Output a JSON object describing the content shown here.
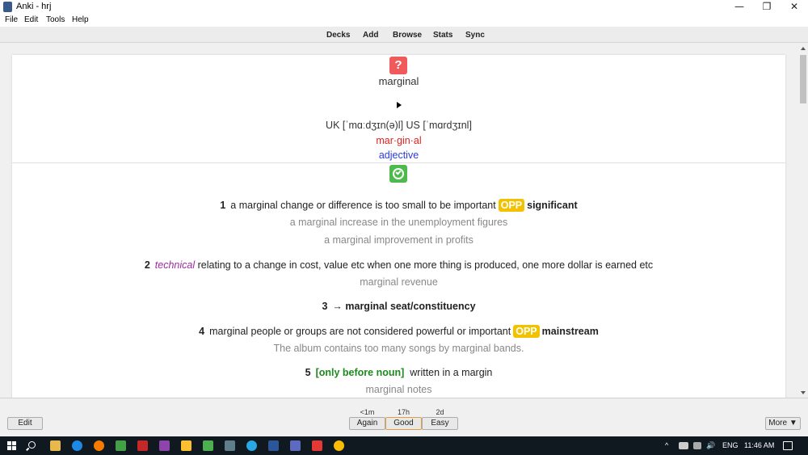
{
  "window": {
    "title": "Anki - hrj",
    "minimize": "—",
    "restore": "❐",
    "close": "✕"
  },
  "menu": {
    "file": "File",
    "edit": "Edit",
    "tools": "Tools",
    "help": "Help"
  },
  "toolbar": {
    "decks": "Decks",
    "add": "Add",
    "browse": "Browse",
    "stats": "Stats",
    "sync": "Sync"
  },
  "card": {
    "question_icon": "?",
    "word": "marginal",
    "pronunciation": "UK [ˈmɑːdʒɪn(ə)l] US [ˈmɑrdʒɪnl]",
    "syllables": "mar·gin·al",
    "part_of_speech": "adjective",
    "senses": [
      {
        "num": "1",
        "def": "a marginal change or difference is too small to be important",
        "opp_label": "OPP",
        "opp": "significant",
        "examples": [
          "a marginal increase in the unemployment figures",
          "a marginal improvement in profits"
        ]
      },
      {
        "num": "2",
        "register": "technical",
        "def": "relating to a change in cost, value etc when one more thing is produced, one more dollar is earned etc",
        "examples": [
          "marginal revenue"
        ]
      },
      {
        "num": "3",
        "arrow": "→",
        "crossref": "marginal seat/constituency"
      },
      {
        "num": "4",
        "def": "marginal people or groups are not considered powerful or important",
        "opp_label": "OPP",
        "opp": "mainstream",
        "examples": [
          "The album contains too many songs by marginal bands."
        ]
      },
      {
        "num": "5",
        "grammar_open": "[",
        "grammar": "only before noun",
        "grammar_close": "]",
        "def": "written in a margin",
        "examples": [
          "marginal notes"
        ]
      }
    ]
  },
  "bottom": {
    "edit": "Edit",
    "again_time": "<1m",
    "again": "Again",
    "good_time": "17h",
    "good": "Good",
    "easy_time": "2d",
    "easy": "Easy",
    "more": "More ▼"
  },
  "taskbar": {
    "tray_arrow": "^",
    "speaker": "🔊",
    "lang": "ENG",
    "time": "11:46 AM",
    "notification_icon": "notification-icon"
  },
  "colors": {
    "qicon": "#f05a5a",
    "aicon": "#4cbb4c",
    "opp": "#f2c200",
    "syll": "#e02020",
    "pos": "#2a3ae0",
    "register": "#9c2aa0",
    "grammar": "#1e8a1e"
  }
}
